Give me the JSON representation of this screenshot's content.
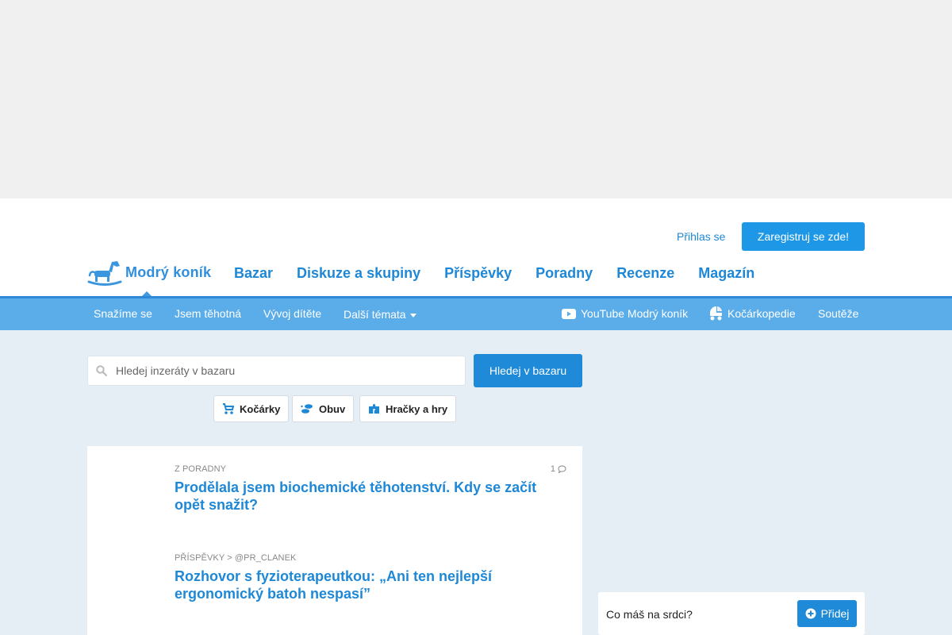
{
  "header": {
    "login_label": "Přihlas se",
    "register_label": "Zaregistruj se zde!",
    "logo_text": "Modrý koník"
  },
  "main_nav": [
    {
      "label": "Bazar"
    },
    {
      "label": "Diskuze a skupiny"
    },
    {
      "label": "Příspěvky"
    },
    {
      "label": "Poradny"
    },
    {
      "label": "Recenze"
    },
    {
      "label": "Magazín"
    }
  ],
  "sub_nav": {
    "left": [
      {
        "label": "Snažíme se"
      },
      {
        "label": "Jsem těhotná"
      },
      {
        "label": "Vývoj dítěte"
      },
      {
        "label": "Další témata"
      }
    ],
    "right": [
      {
        "label": "YouTube Modrý koník",
        "icon": "youtube-icon"
      },
      {
        "label": "Kočárkopedie",
        "icon": "stroller-icon"
      },
      {
        "label": "Soutěže"
      }
    ]
  },
  "search": {
    "placeholder": "Hledej inzeráty v bazaru",
    "button_label": "Hledej v bazaru"
  },
  "categories": [
    {
      "label": "Kočárky",
      "icon": "stroller-icon"
    },
    {
      "label": "Obuv",
      "icon": "footprints-icon"
    },
    {
      "label": "Hračky a hry",
      "icon": "puzzle-icon"
    }
  ],
  "feed": [
    {
      "meta": "Z PORADNY",
      "title": "Prodělala jsem biochemické těhotenství. Kdy se začít opět snažit?",
      "comments": "1"
    },
    {
      "meta": "PŘÍSPĚVKY > @PR_CLANEK",
      "title": "Rozhovor s fyzioterapeutkou: „Ani ten nejlepší ergonomický batoh nespasí”"
    }
  ],
  "post": {
    "prompt": "Co máš na srdci?",
    "button_label": "Přidej"
  },
  "colors": {
    "brand_blue": "#1e88d6",
    "subnav_bg": "#5aade9",
    "page_bg": "#e6eef5"
  }
}
